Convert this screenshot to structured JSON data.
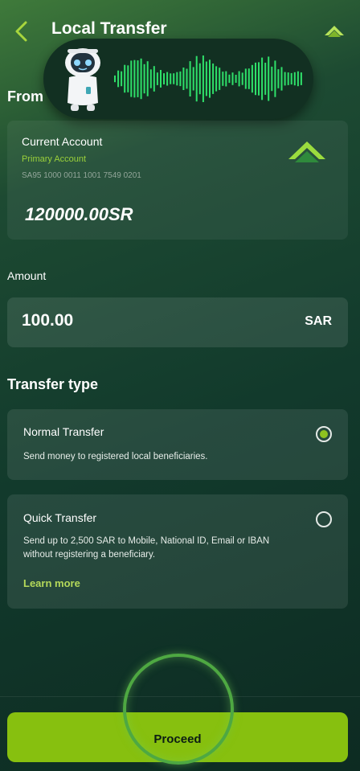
{
  "header": {
    "title": "Local Transfer"
  },
  "from": {
    "label": "From",
    "account": {
      "name": "Current Account",
      "type": "Primary Account",
      "iban": "SA95 1000 0011 1001 7549 0201",
      "balance": "120000.00SR"
    }
  },
  "amount": {
    "label": "Amount",
    "value": "100.00",
    "currency": "SAR"
  },
  "transfer_type": {
    "label": "Transfer type",
    "options": [
      {
        "title": "Normal Transfer",
        "description": "Send money to registered local beneficiaries.",
        "selected": true
      },
      {
        "title": "Quick Transfer",
        "description_line1": "Send up to 2,500 SAR to Mobile, National ID, Email or IBAN",
        "description_line2": "without registering a beneficiary.",
        "link": "Learn more",
        "selected": false
      }
    ]
  },
  "proceed_label": "Proceed",
  "colors": {
    "accent": "#87c00f",
    "radio_selected": "#8dc21f",
    "background": "#123a2c"
  },
  "icons": [
    "chevron-left-icon",
    "brand-logo-icon",
    "robot-assistant-icon",
    "voice-waveform-icon",
    "microphone-ring-icon"
  ]
}
